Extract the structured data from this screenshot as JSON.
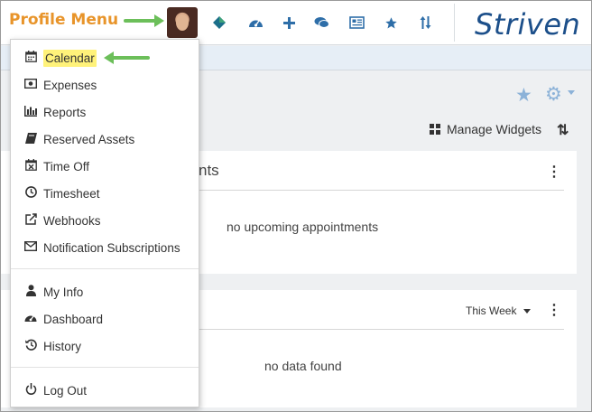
{
  "annotation": {
    "label": "Profile Menu"
  },
  "header": {
    "logo": "Striven",
    "nav_icons": [
      "diamond-icon",
      "dashboard-icon",
      "plus-icon",
      "chat-icon",
      "newspaper-icon",
      "star-icon",
      "sort-icon"
    ]
  },
  "toolbar": {
    "manage_widgets": "Manage Widgets"
  },
  "panels": {
    "appointments": {
      "title_fragment": "nts",
      "empty": "no upcoming appointments"
    },
    "second": {
      "filter": "This Week",
      "empty": "no data found"
    }
  },
  "menu": {
    "group1": [
      {
        "label": "Calendar",
        "icon": "calendar-icon"
      },
      {
        "label": "Expenses",
        "icon": "money-icon"
      },
      {
        "label": "Reports",
        "icon": "bar-chart-icon"
      },
      {
        "label": "Reserved Assets",
        "icon": "book-icon"
      },
      {
        "label": "Time Off",
        "icon": "calendar-x-icon"
      },
      {
        "label": "Timesheet",
        "icon": "clock-icon"
      },
      {
        "label": "Webhooks",
        "icon": "external-link-icon"
      },
      {
        "label": "Notification Subscriptions",
        "icon": "envelope-icon"
      }
    ],
    "group2": [
      {
        "label": "My Info",
        "icon": "user-icon"
      },
      {
        "label": "Dashboard",
        "icon": "dashboard-icon"
      },
      {
        "label": "History",
        "icon": "history-icon"
      }
    ],
    "group3": [
      {
        "label": "Log Out",
        "icon": "power-icon"
      }
    ]
  },
  "colors": {
    "brand": "#1c4f8a",
    "accent": "#2e6ea8",
    "annotation": "#e8942a",
    "arrow": "#6cbf5a",
    "highlight": "#fff27a"
  }
}
